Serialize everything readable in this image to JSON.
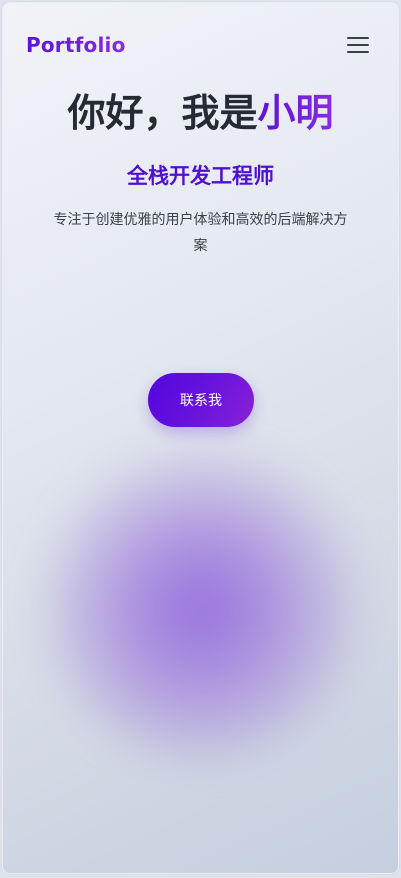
{
  "nav": {
    "logo": "Portfolio",
    "menu_icon": "hamburger-menu-icon"
  },
  "hero": {
    "greeting": "你好，我是",
    "name": "小明",
    "subtitle": "全栈开发工程师",
    "description": "专注于创建优雅的用户体验和高效的后端解决方案",
    "cta_label": "联系我"
  },
  "colors": {
    "accent": "#5a14d6",
    "accent_light": "#8a2be2",
    "text_dark": "#262b33",
    "glow": "#8c5fdc"
  }
}
